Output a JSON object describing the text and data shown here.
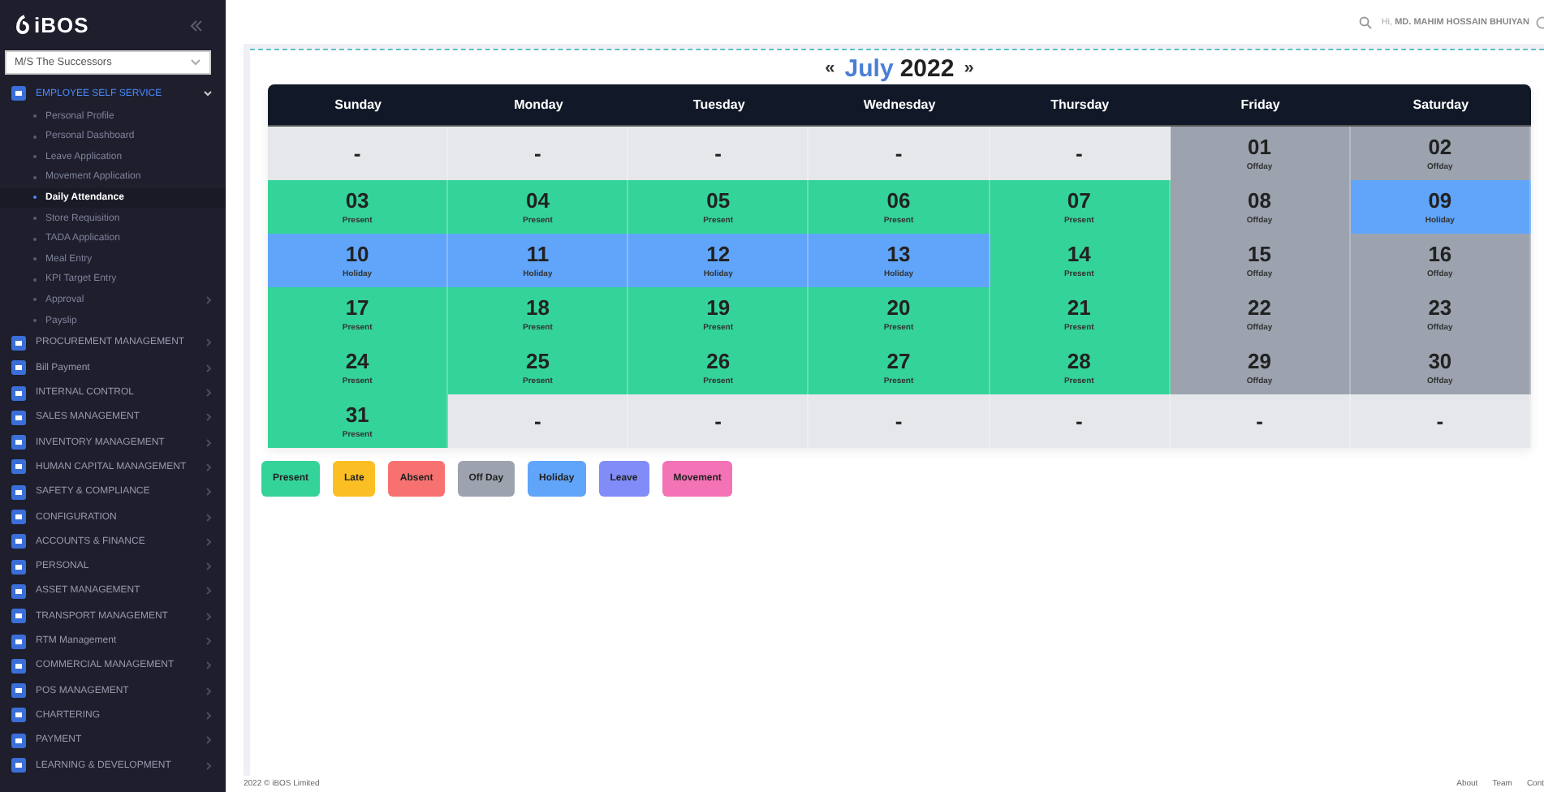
{
  "sidebar": {
    "logo": "iBOS",
    "company": "M/S The Successors",
    "menu": [
      {
        "label": "EMPLOYEE SELF SERVICE",
        "expanded": true,
        "children": [
          {
            "label": "Personal Profile",
            "selected": false,
            "has_submenu": false
          },
          {
            "label": "Personal Dashboard",
            "selected": false,
            "has_submenu": false
          },
          {
            "label": "Leave Application",
            "selected": false,
            "has_submenu": false
          },
          {
            "label": "Movement Application",
            "selected": false,
            "has_submenu": false
          },
          {
            "label": "Daily Attendance",
            "selected": true,
            "has_submenu": false
          },
          {
            "label": "Store Requisition",
            "selected": false,
            "has_submenu": false
          },
          {
            "label": "TADA Application",
            "selected": false,
            "has_submenu": false
          },
          {
            "label": "Meal Entry",
            "selected": false,
            "has_submenu": false
          },
          {
            "label": "KPI Target Entry",
            "selected": false,
            "has_submenu": false
          },
          {
            "label": "Approval",
            "selected": false,
            "has_submenu": true
          },
          {
            "label": "Payslip",
            "selected": false,
            "has_submenu": false
          }
        ]
      },
      {
        "label": "PROCUREMENT MANAGEMENT",
        "expanded": false
      },
      {
        "label": "Bill Payment",
        "expanded": false
      },
      {
        "label": "INTERNAL CONTROL",
        "expanded": false
      },
      {
        "label": "SALES MANAGEMENT",
        "expanded": false
      },
      {
        "label": "INVENTORY MANAGEMENT",
        "expanded": false
      },
      {
        "label": "HUMAN CAPITAL MANAGEMENT",
        "expanded": false
      },
      {
        "label": "SAFETY & COMPLIANCE",
        "expanded": false
      },
      {
        "label": "CONFIGURATION",
        "expanded": false
      },
      {
        "label": "ACCOUNTS & FINANCE",
        "expanded": false
      },
      {
        "label": "PERSONAL",
        "expanded": false
      },
      {
        "label": "ASSET MANAGEMENT",
        "expanded": false
      },
      {
        "label": "TRANSPORT MANAGEMENT",
        "expanded": false
      },
      {
        "label": "RTM Management",
        "expanded": false
      },
      {
        "label": "COMMERCIAL MANAGEMENT",
        "expanded": false
      },
      {
        "label": "POS MANAGEMENT",
        "expanded": false
      },
      {
        "label": "CHARTERING",
        "expanded": false
      },
      {
        "label": "PAYMENT",
        "expanded": false
      },
      {
        "label": "LEARNING & DEVELOPMENT",
        "expanded": false
      }
    ]
  },
  "header": {
    "greeting": "Hi,",
    "user": "MD. MAHIM HOSSAIN BHUIYAN"
  },
  "calendar": {
    "month": "July",
    "year": "2022",
    "prev": "«",
    "next": "»",
    "weekdays": [
      "Sunday",
      "Monday",
      "Tuesday",
      "Wednesday",
      "Thursday",
      "Friday",
      "Saturday"
    ],
    "weeks": [
      [
        {
          "kind": "empty",
          "day": "-"
        },
        {
          "kind": "empty",
          "day": "-"
        },
        {
          "kind": "empty",
          "day": "-"
        },
        {
          "kind": "empty",
          "day": "-"
        },
        {
          "kind": "empty",
          "day": "-"
        },
        {
          "kind": "offday",
          "day": "01",
          "status": "Offday"
        },
        {
          "kind": "offday",
          "day": "02",
          "status": "Offday"
        }
      ],
      [
        {
          "kind": "present",
          "day": "03",
          "status": "Present"
        },
        {
          "kind": "present",
          "day": "04",
          "status": "Present"
        },
        {
          "kind": "present",
          "day": "05",
          "status": "Present"
        },
        {
          "kind": "present",
          "day": "06",
          "status": "Present"
        },
        {
          "kind": "present",
          "day": "07",
          "status": "Present"
        },
        {
          "kind": "offday",
          "day": "08",
          "status": "Offday"
        },
        {
          "kind": "holiday",
          "day": "09",
          "status": "Holiday"
        }
      ],
      [
        {
          "kind": "holiday",
          "day": "10",
          "status": "Holiday"
        },
        {
          "kind": "holiday",
          "day": "11",
          "status": "Holiday"
        },
        {
          "kind": "holiday",
          "day": "12",
          "status": "Holiday"
        },
        {
          "kind": "holiday",
          "day": "13",
          "status": "Holiday"
        },
        {
          "kind": "present",
          "day": "14",
          "status": "Present"
        },
        {
          "kind": "offday",
          "day": "15",
          "status": "Offday"
        },
        {
          "kind": "offday",
          "day": "16",
          "status": "Offday"
        }
      ],
      [
        {
          "kind": "present",
          "day": "17",
          "status": "Present"
        },
        {
          "kind": "present",
          "day": "18",
          "status": "Present"
        },
        {
          "kind": "present",
          "day": "19",
          "status": "Present"
        },
        {
          "kind": "present",
          "day": "20",
          "status": "Present"
        },
        {
          "kind": "present",
          "day": "21",
          "status": "Present"
        },
        {
          "kind": "offday",
          "day": "22",
          "status": "Offday"
        },
        {
          "kind": "offday",
          "day": "23",
          "status": "Offday"
        }
      ],
      [
        {
          "kind": "present",
          "day": "24",
          "status": "Present"
        },
        {
          "kind": "present",
          "day": "25",
          "status": "Present"
        },
        {
          "kind": "present",
          "day": "26",
          "status": "Present"
        },
        {
          "kind": "present",
          "day": "27",
          "status": "Present"
        },
        {
          "kind": "present",
          "day": "28",
          "status": "Present"
        },
        {
          "kind": "offday",
          "day": "29",
          "status": "Offday"
        },
        {
          "kind": "offday",
          "day": "30",
          "status": "Offday"
        }
      ],
      [
        {
          "kind": "present",
          "day": "31",
          "status": "Present"
        },
        {
          "kind": "empty",
          "day": "-"
        },
        {
          "kind": "empty",
          "day": "-"
        },
        {
          "kind": "empty",
          "day": "-"
        },
        {
          "kind": "empty",
          "day": "-"
        },
        {
          "kind": "empty",
          "day": "-"
        },
        {
          "kind": "empty",
          "day": "-"
        }
      ]
    ],
    "legend": [
      {
        "label": "Present",
        "color": "#34d399"
      },
      {
        "label": "Late",
        "color": "#fbbf24"
      },
      {
        "label": "Absent",
        "color": "#f87171"
      },
      {
        "label": "Off Day",
        "color": "#9ca3af"
      },
      {
        "label": "Holiday",
        "color": "#60a5fa"
      },
      {
        "label": "Leave",
        "color": "#818cf8"
      },
      {
        "label": "Movement",
        "color": "#f472b6"
      }
    ]
  },
  "footer": {
    "copyright": "2022 © iBOS Limited",
    "links": [
      "About",
      "Team",
      "Cont"
    ]
  }
}
